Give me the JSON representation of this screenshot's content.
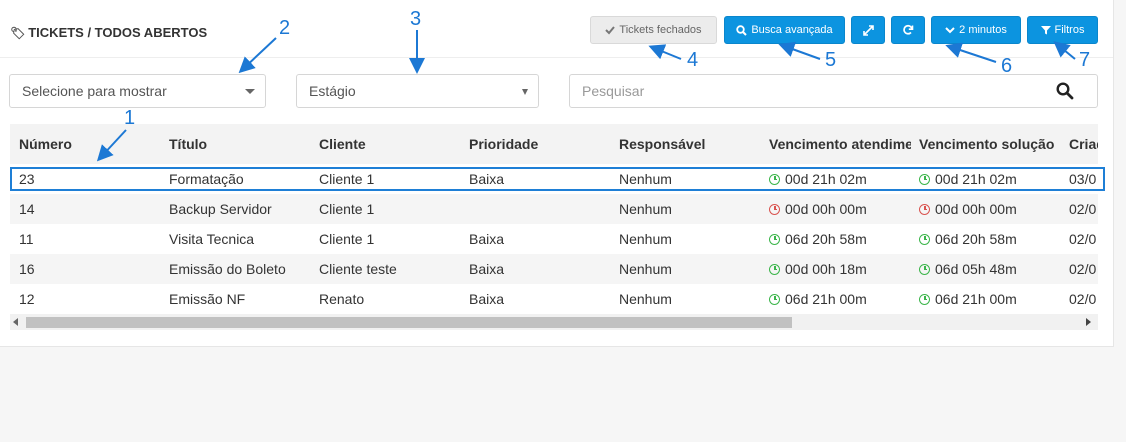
{
  "header": {
    "title": "TICKETS / TODOS ABERTOS",
    "tickets_fechados": "Tickets fechados",
    "busca_avancada": "Busca avançada",
    "refresh_interval": "2 minutos",
    "filtros": "Filtros"
  },
  "filters": {
    "show_select": "Selecione para mostrar",
    "stage_select": "Estágio",
    "search_placeholder": "Pesquisar"
  },
  "table": {
    "columns": [
      "Número",
      "Título",
      "Cliente",
      "Prioridade",
      "Responsável",
      "Vencimento atendimento",
      "Vencimento solução",
      "Criado"
    ],
    "rows": [
      {
        "numero": "23",
        "titulo": "Formatação",
        "cliente": "Cliente 1",
        "prioridade": "Baixa",
        "responsavel": "Nenhum",
        "venc_atendimento": "00d 21h 02m",
        "venc_solucao": "00d 21h 02m",
        "criado": "03/0",
        "status_atendimento": "green",
        "status_solucao": "green"
      },
      {
        "numero": "14",
        "titulo": "Backup Servidor",
        "cliente": "Cliente 1",
        "prioridade": "",
        "responsavel": "Nenhum",
        "venc_atendimento": "00d 00h 00m",
        "venc_solucao": "00d 00h 00m",
        "criado": "02/0",
        "status_atendimento": "red",
        "status_solucao": "red"
      },
      {
        "numero": "11",
        "titulo": "Visita Tecnica",
        "cliente": "Cliente 1",
        "prioridade": "Baixa",
        "responsavel": "Nenhum",
        "venc_atendimento": "06d 20h 58m",
        "venc_solucao": "06d 20h 58m",
        "criado": "02/0",
        "status_atendimento": "green",
        "status_solucao": "green"
      },
      {
        "numero": "16",
        "titulo": "Emissão do Boleto",
        "cliente": "Cliente teste",
        "prioridade": "Baixa",
        "responsavel": "Nenhum",
        "venc_atendimento": "00d 00h 18m",
        "venc_solucao": "06d 05h 48m",
        "criado": "02/0",
        "status_atendimento": "green",
        "status_solucao": "green"
      },
      {
        "numero": "12",
        "titulo": "Emissão NF",
        "cliente": "Renato",
        "prioridade": "Baixa",
        "responsavel": "Nenhum",
        "venc_atendimento": "06d 21h 00m",
        "venc_solucao": "06d 21h 00m",
        "criado": "02/0",
        "status_atendimento": "green",
        "status_solucao": "green"
      }
    ]
  },
  "annotations": [
    "1",
    "2",
    "3",
    "4",
    "5",
    "6",
    "7"
  ],
  "colors": {
    "primary_button": "#0c94e0",
    "annotation": "#1c78d4",
    "status_green": "#3bb54a",
    "status_red": "#d9534f"
  },
  "icons": {
    "title": "tag-icon",
    "tickets_fechados": "check-icon",
    "busca_avancada": "search-icon",
    "expand": "expand-icon",
    "refresh": "refresh-icon",
    "interval": "chevron-down-icon",
    "filtros": "filter-icon",
    "search_field": "search-icon",
    "due": "clock-icon"
  }
}
